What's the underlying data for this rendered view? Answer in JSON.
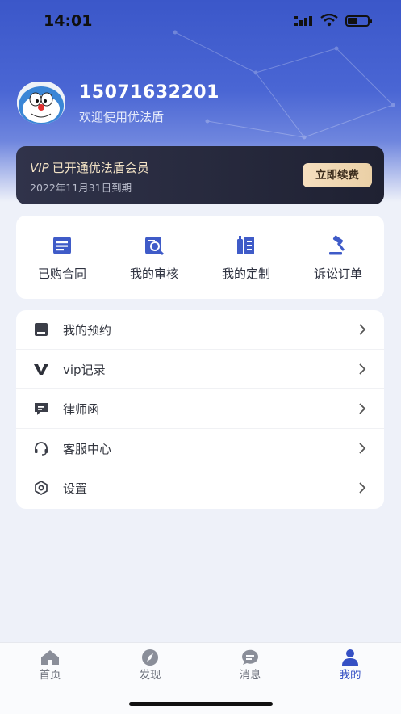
{
  "status_bar": {
    "time": "14:01"
  },
  "profile": {
    "phone": "15071632201",
    "welcome": "欢迎使用优法盾"
  },
  "vip_card": {
    "badge": "VIP",
    "title": "已开通优法盾会员",
    "expiry": "2022年11月31日到期",
    "renew_label": "立即续费"
  },
  "quick_actions": [
    {
      "label": "已购合同",
      "icon": "contract-icon"
    },
    {
      "label": "我的审核",
      "icon": "review-search-icon"
    },
    {
      "label": "我的定制",
      "icon": "custom-books-icon"
    },
    {
      "label": "诉讼订单",
      "icon": "gavel-icon"
    }
  ],
  "menu": [
    {
      "label": "我的预约",
      "icon": "book-icon"
    },
    {
      "label": "vip记录",
      "icon": "vip-v-icon"
    },
    {
      "label": "律师函",
      "icon": "letter-icon"
    },
    {
      "label": "客服中心",
      "icon": "headset-icon"
    },
    {
      "label": "设置",
      "icon": "hexagon-settings-icon"
    }
  ],
  "tabs": [
    {
      "label": "首页",
      "icon": "home-icon"
    },
    {
      "label": "发现",
      "icon": "compass-icon"
    },
    {
      "label": "消息",
      "icon": "chat-icon"
    },
    {
      "label": "我的",
      "icon": "user-icon"
    }
  ],
  "colors": {
    "primary": "#3B57C9",
    "vip_gold": "#F1E1C4",
    "icon_blue": "#3F5BC8",
    "active_tab": "#3550C4"
  }
}
